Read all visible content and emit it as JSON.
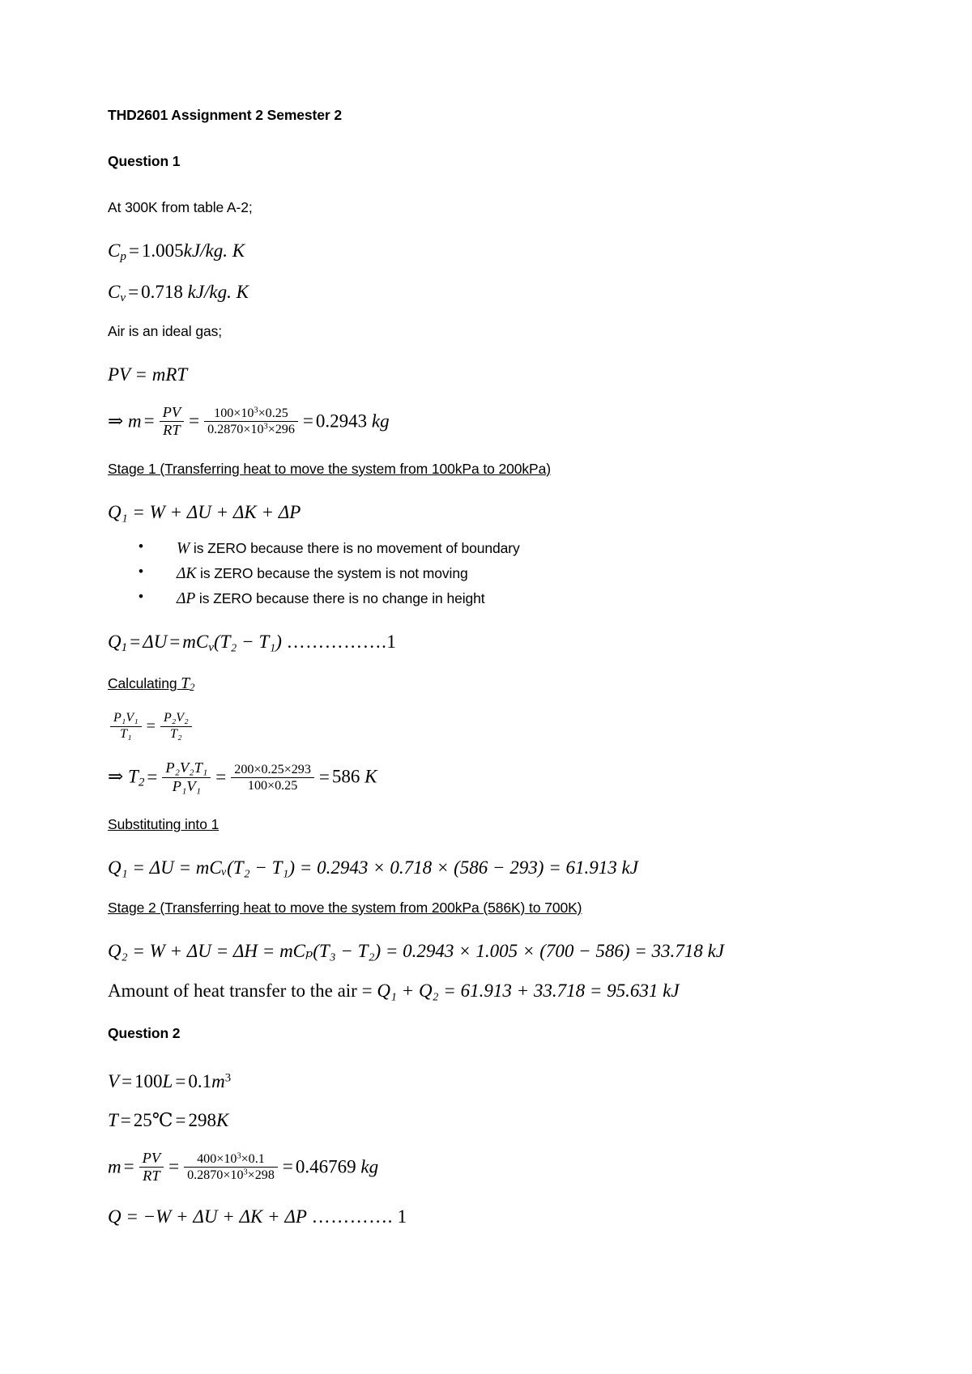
{
  "document": {
    "title": "THD2601 Assignment 2 Semester 2",
    "question1_heading": "Question 1",
    "question2_heading": "Question 2"
  },
  "q1": {
    "table_note": "At 300K from table A-2;",
    "cp": {
      "symbol": "C",
      "sub": "p",
      "eq": "=",
      "value": "1.005",
      "units": "kJ/kg. K"
    },
    "cv": {
      "symbol": "C",
      "sub": "v",
      "eq": "=",
      "value": "0.718",
      "units": "kJ/kg. K"
    },
    "ideal_gas_note": "Air is an ideal gas;",
    "ideal_gas_law": "PV = mRT",
    "mass_calc": {
      "implies": "⇒",
      "lhs": "m",
      "frac1_num": "PV",
      "frac1_den": "RT",
      "frac2_num": "100×10",
      "frac2_num_exp": "3",
      "frac2_num_tail": "×0.25",
      "frac2_den": "0.2870×10",
      "frac2_den_exp": "3",
      "frac2_den_tail": "×296",
      "result": "0.2943",
      "units": "kg"
    },
    "stage1_heading": "Stage 1 (Transferring heat to move the system from 100kPa to 200kPa)",
    "stage1_energy_balance": "Q₁ = W + ΔU + ΔK + ΔP",
    "bullets": [
      {
        "symbol": "W",
        "text": " is ZERO because there is no movement of boundary"
      },
      {
        "symbol": "ΔK",
        "text": " is ZERO because the system is not moving"
      },
      {
        "symbol": "ΔP",
        "text": " is ZERO because there is no change in height"
      }
    ],
    "q1_reduced": {
      "lhs": "Q",
      "lhs_sub": "1",
      "mid": "ΔU",
      "rhs": "mC",
      "rhs_sub": "v",
      "bracket": "(T₂ − T₁)",
      "dots": "…………….",
      "ref": "1"
    },
    "calculating_t2_label": "Calculating ",
    "calculating_t2_symbol": "T",
    "calculating_t2_sub": "2",
    "combined_gas_law": {
      "left_num": "P₁V₁",
      "left_den": "T₁",
      "right_num": "P₂V₂",
      "right_den": "T₂"
    },
    "t2_solution": {
      "implies": "⇒",
      "lhs": "T",
      "lhs_sub": "2",
      "frac1_num": "P₂V₂T₁",
      "frac1_den": "P₁V₁",
      "frac2_num": "200×0.25×293",
      "frac2_den": "100×0.25",
      "result": "586",
      "units": "K"
    },
    "substituting_heading": "Substituting into 1",
    "q1_value_line": {
      "expr": "Q₁ = ΔU = mCᵥ(T₂ − T₁) = 0.2943 × 0.718 × (586 − 293) = 61.913",
      "units": "kJ"
    },
    "stage2_heading": "Stage 2 (Transferring heat to move the system from 200kPa (586K) to 700K)",
    "q2_value_line": {
      "expr": "Q₂ = W + ΔU = ΔH = mCₚ(T₃ − T₂) = 0.2943 × 1.005 × (700 − 586) = 33.718",
      "units": "kJ"
    },
    "total_heat_line": {
      "label": "Amount of heat transfer to the air = ",
      "expr": "Q₁ + Q₂ = 61.913 + 33.718 = 95.631",
      "units": "kJ"
    }
  },
  "q2": {
    "volume": {
      "symbol": "V",
      "eq": "=",
      "value1": "100",
      "unit1": "L",
      "eq2": "=",
      "value2": "0.1",
      "unit2": "m",
      "exp": "3"
    },
    "temperature": {
      "symbol": "T",
      "eq": "=",
      "value1": "25",
      "unit1": "℃",
      "eq2": "=",
      "value2": "298",
      "unit2": "K"
    },
    "mass_calc": {
      "lhs": "m",
      "frac1_num": "PV",
      "frac1_den": "RT",
      "frac2_num": "400×10",
      "frac2_num_exp": "3",
      "frac2_num_tail": "×0.1",
      "frac2_den": "0.2870×10",
      "frac2_den_exp": "3",
      "frac2_den_tail": "×298",
      "result": "0.46769",
      "units": "kg"
    },
    "energy_balance": {
      "expr": "Q = −W + ΔU + ΔK + ΔP",
      "dots": "………….",
      "ref": "1"
    }
  }
}
